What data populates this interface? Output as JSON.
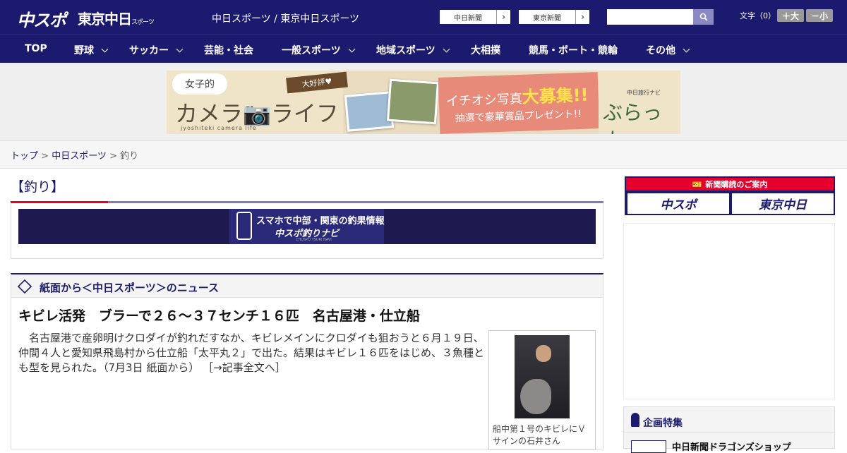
{
  "header": {
    "logo_chuspo": "中スポ",
    "logo_tokyo": "東京中日",
    "logo_tokyo_small": "スポーツ",
    "site_title": "中日スポーツ / 東京中日スポーツ",
    "paper_buttons": [
      "中日新聞",
      "東京新聞"
    ],
    "search_placeholder": "",
    "font_size_label": "文字（0）",
    "font_larger": "＋大",
    "font_smaller": "－小"
  },
  "nav": {
    "items": [
      {
        "label": "TOP",
        "dropdown": false
      },
      {
        "label": "野球",
        "dropdown": true
      },
      {
        "label": "サッカー",
        "dropdown": true
      },
      {
        "label": "芸能・社会",
        "dropdown": false
      },
      {
        "label": "一般スポーツ",
        "dropdown": true
      },
      {
        "label": "地域スポーツ",
        "dropdown": true
      },
      {
        "label": "大相撲",
        "dropdown": false
      },
      {
        "label": "競馬・ボート・競輪",
        "dropdown": false
      },
      {
        "label": "その他",
        "dropdown": true
      }
    ]
  },
  "ad_banner": {
    "joshi": "女子的",
    "camera_life": "カメラ📷ライフ",
    "sub": "jyoshiteki camera life",
    "ribbon": "大好評♥",
    "headline_a": "イチオシ写真",
    "headline_b": "大募集!!",
    "subline": "抽選で豪華賞品プレゼント!!",
    "right_small": "中日旅行ナビ",
    "right_big": "ぶらっ人"
  },
  "breadcrumb": {
    "items": [
      "トップ",
      "中日スポーツ"
    ],
    "current": "釣り",
    "sep": " > "
  },
  "page": {
    "heading": "【釣り】"
  },
  "app_banner": {
    "line1": "スマホで中部・関東の釣果情報",
    "line2": "中スポ釣りナビ",
    "line3": "CHUSPO TSURI NAVI"
  },
  "news": {
    "section_title": "紙面から＜中日スポーツ＞のニュース",
    "headline": "キビレ活発　ブラーで２６～３７センチ１６匹　名古屋港・仕立船",
    "body": "　名古屋港で産卵明けクロダイが釣れだすなか、キビレメインにクロダイも狙おうと６月１９日、仲間４人と愛知県飛島村から仕立船「太平丸２」で出た。結果はキビレ１６匹をはじめ、３魚種とも型を見られた。（7月3日 紙面から）",
    "read_more": "［→記事全文へ］",
    "photo_caption": "船中第１号のキビレにＶサインの石井さん"
  },
  "sidebar": {
    "subscribe_head": "新聞購読のご案内",
    "subscribe_buttons": [
      "中スポ",
      "東京中日"
    ],
    "plan_title": "企画特集",
    "plan_item": "中日新聞ドラゴンズショップ"
  },
  "colors": {
    "brand_navy": "#1c1a6e",
    "accent_red": "#e6002d"
  }
}
